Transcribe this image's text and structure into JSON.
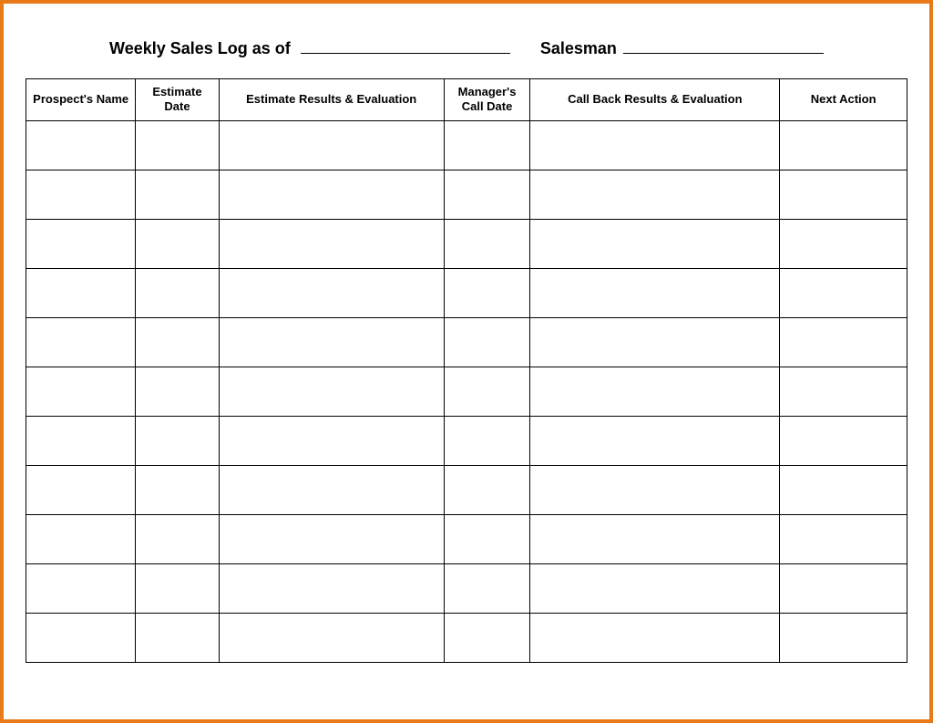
{
  "header": {
    "title_prefix": "Weekly Sales Log as of",
    "salesman_label": "Salesman"
  },
  "table": {
    "columns": [
      "Prospect's Name",
      "Estimate Date",
      "Estimate Results & Evaluation",
      "Manager's Call Date",
      "Call Back Results & Evaluation",
      "Next Action"
    ],
    "row_count": 11
  }
}
